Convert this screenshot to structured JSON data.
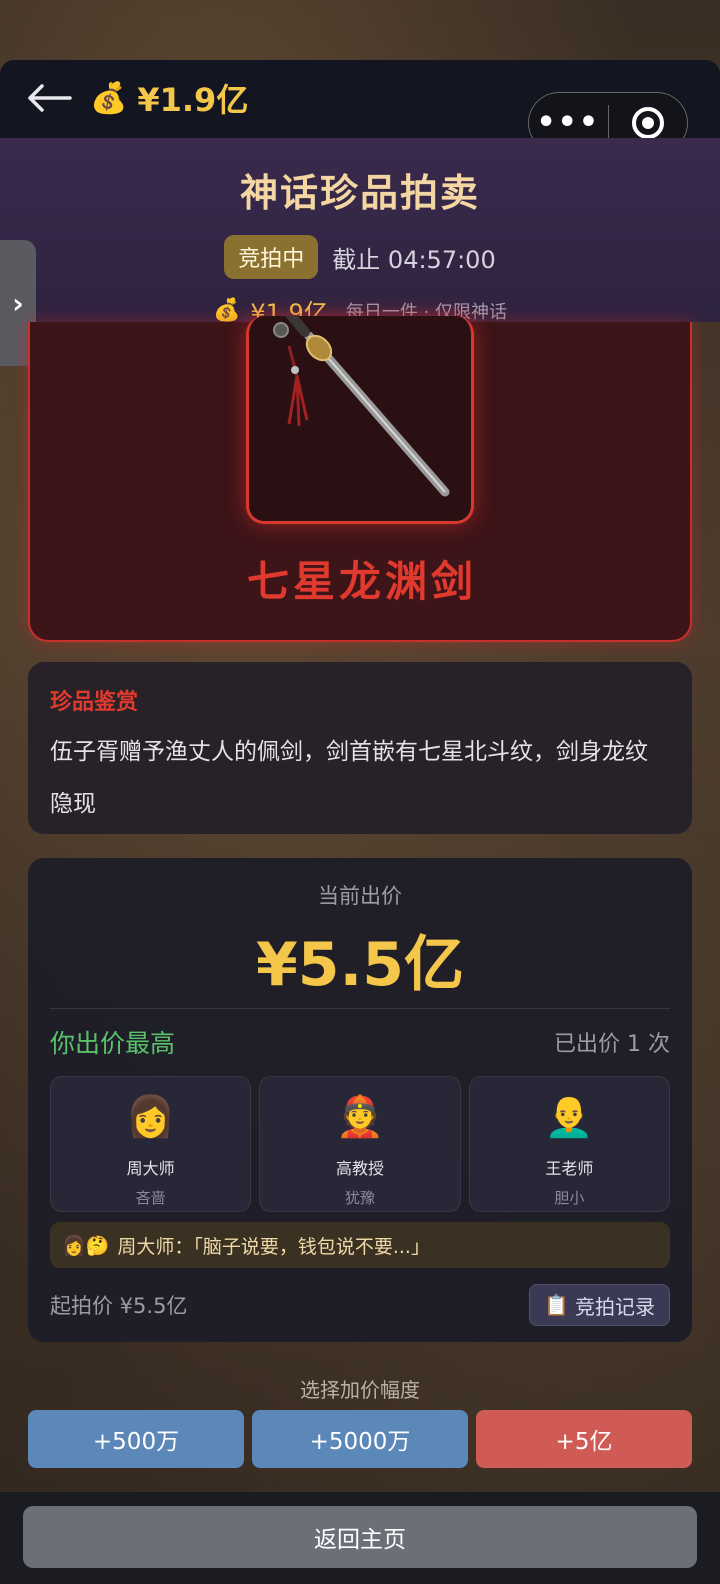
{
  "topbar": {
    "balance_icon": "money-bag-icon",
    "balance": "¥1.9亿"
  },
  "header": {
    "title": "神话珍品拍卖",
    "status_badge": "竞拍中",
    "deadline": "截止 04:57:00",
    "price": "¥1.9亿",
    "note": "每日一件 · 仅限神话"
  },
  "item": {
    "name": "七星龙渊剑"
  },
  "description": {
    "title": "珍品鉴赏",
    "text": "伍子胥赠予渔丈人的佩剑，剑首嵌有七星北斗纹，剑身龙纹隐现"
  },
  "bid": {
    "current_label": "当前出价",
    "current_price": "¥5.5亿",
    "top_status": "你出价最高",
    "bid_count": "已出价 1 次",
    "bidders": [
      {
        "emoji": "👩",
        "name": "周大师",
        "trait": "吝啬"
      },
      {
        "emoji": "👲",
        "name": "高教授",
        "trait": "犹豫"
      },
      {
        "emoji": "👨‍🦲",
        "name": "王老师",
        "trait": "胆小"
      }
    ],
    "quote_emoji": "👩🤔",
    "quote": "周大师：「脑子说要，钱包说不要...」",
    "start_price": "起拍价 ¥5.5亿",
    "record_icon": "📋",
    "record_label": "竞拍记录"
  },
  "increment": {
    "label": "选择加价幅度",
    "options": [
      "+500万",
      "+5000万",
      "+5亿"
    ]
  },
  "home_button": "返回主页",
  "colors": {
    "gold": "#f4c64a",
    "red_accent": "#e0392e",
    "green": "#59c26a",
    "blue_button": "#5b88b8",
    "red_button": "#d05b55"
  }
}
